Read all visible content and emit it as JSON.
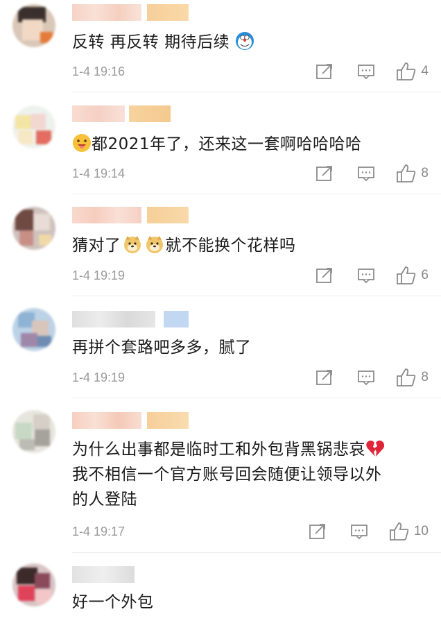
{
  "comments": [
    {
      "text_parts": [
        "反转 再反转 期待后续",
        ""
      ],
      "time": "1-4 19:16",
      "likes": "4",
      "emoji": "doraemon-emoji"
    },
    {
      "text_parts": [
        "",
        "都2021年了，还来这一套啊哈哈哈哈"
      ],
      "time": "1-4 19:14",
      "likes": "8",
      "emoji": "grin-emoji"
    },
    {
      "text_parts": [
        "猜对了",
        "就不能换个花样吗"
      ],
      "time": "1-4 19:19",
      "likes": "6",
      "emoji": "doge-emoji"
    },
    {
      "text_parts": [
        "再拼个套路吧多多，腻了"
      ],
      "time": "1-4 19:19",
      "likes": "8"
    },
    {
      "text_lines": [
        "为什么出事都是临时工和外包背黑锅悲哀",
        "我不相信一个官方账号回会随便让领导以外",
        "的人登陆"
      ],
      "time": "1-4 19:17",
      "likes": "10",
      "emoji": "broken-heart-emoji"
    },
    {
      "text_parts": [
        "好一个外包"
      ]
    }
  ]
}
